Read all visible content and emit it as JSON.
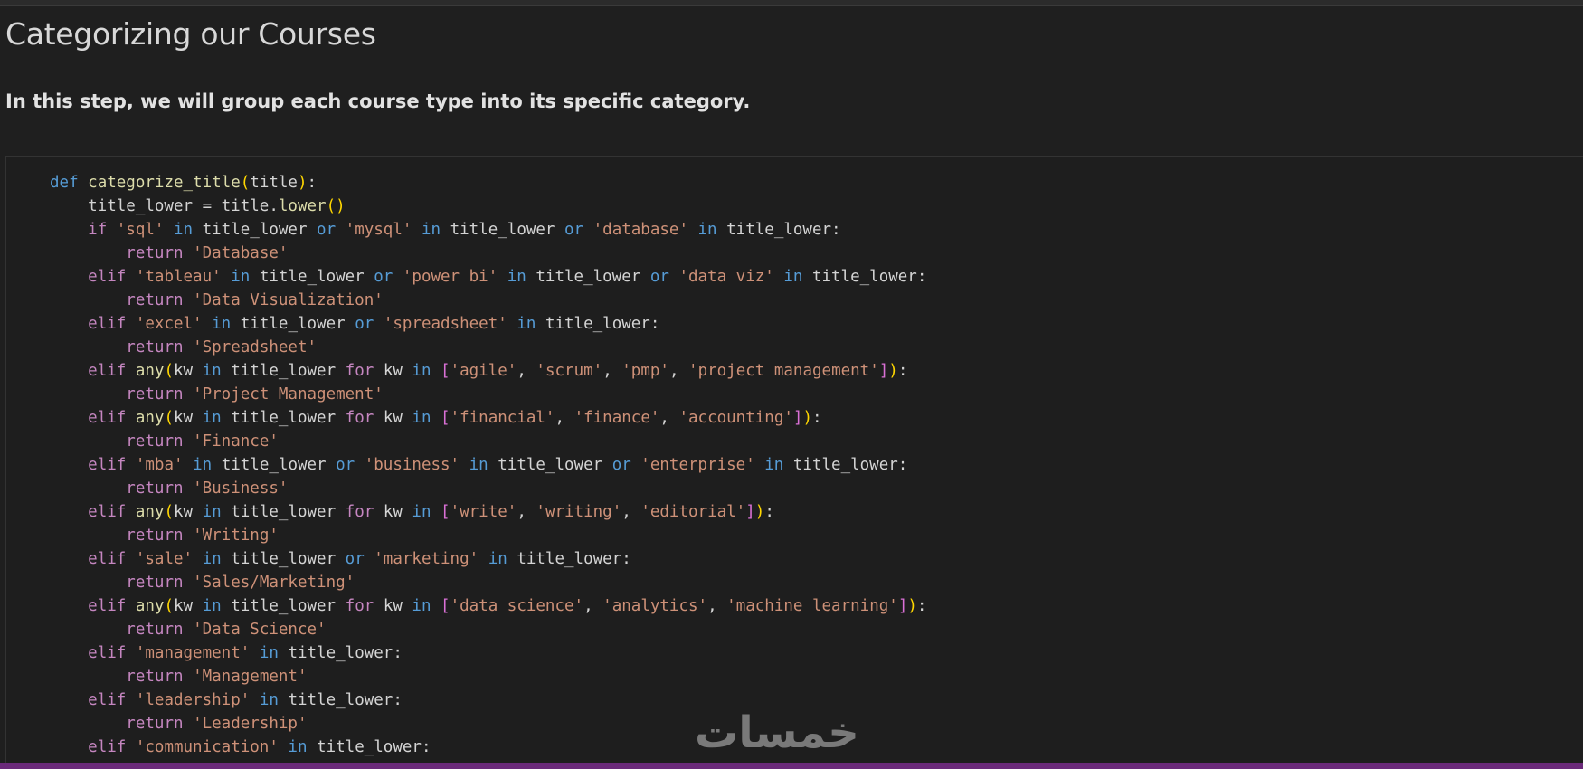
{
  "heading": "Categorizing our Courses",
  "intro": "In this step, we will group each course type into its specific category.",
  "watermark": "خمسات",
  "code_lines": [
    [
      {
        "t": "def ",
        "c": "kw"
      },
      {
        "t": "categorize_title",
        "c": "fn"
      },
      {
        "t": "(",
        "c": "br1"
      },
      {
        "t": "title",
        "c": "id"
      },
      {
        "t": ")",
        "c": "br1"
      },
      {
        "t": ":",
        "c": "id"
      }
    ],
    [
      {
        "t": "    title_lower = title.",
        "c": "id"
      },
      {
        "t": "lower",
        "c": "fn"
      },
      {
        "t": "()",
        "c": "br1"
      }
    ],
    [
      {
        "t": "    ",
        "c": "id"
      },
      {
        "t": "if ",
        "c": "ctl"
      },
      {
        "t": "'sql'",
        "c": "str"
      },
      {
        "t": " in ",
        "c": "kw"
      },
      {
        "t": "title_lower ",
        "c": "id"
      },
      {
        "t": "or ",
        "c": "kw"
      },
      {
        "t": "'mysql'",
        "c": "str"
      },
      {
        "t": " in ",
        "c": "kw"
      },
      {
        "t": "title_lower ",
        "c": "id"
      },
      {
        "t": "or ",
        "c": "kw"
      },
      {
        "t": "'database'",
        "c": "str"
      },
      {
        "t": " in ",
        "c": "kw"
      },
      {
        "t": "title_lower:",
        "c": "id"
      }
    ],
    [
      {
        "t": "        ",
        "c": "id"
      },
      {
        "t": "return ",
        "c": "ctl"
      },
      {
        "t": "'Database'",
        "c": "str"
      }
    ],
    [
      {
        "t": "    ",
        "c": "id"
      },
      {
        "t": "elif ",
        "c": "ctl"
      },
      {
        "t": "'tableau'",
        "c": "str"
      },
      {
        "t": " in ",
        "c": "kw"
      },
      {
        "t": "title_lower ",
        "c": "id"
      },
      {
        "t": "or ",
        "c": "kw"
      },
      {
        "t": "'power bi'",
        "c": "str"
      },
      {
        "t": " in ",
        "c": "kw"
      },
      {
        "t": "title_lower ",
        "c": "id"
      },
      {
        "t": "or ",
        "c": "kw"
      },
      {
        "t": "'data viz'",
        "c": "str"
      },
      {
        "t": " in ",
        "c": "kw"
      },
      {
        "t": "title_lower:",
        "c": "id"
      }
    ],
    [
      {
        "t": "        ",
        "c": "id"
      },
      {
        "t": "return ",
        "c": "ctl"
      },
      {
        "t": "'Data Visualization'",
        "c": "str"
      }
    ],
    [
      {
        "t": "    ",
        "c": "id"
      },
      {
        "t": "elif ",
        "c": "ctl"
      },
      {
        "t": "'excel'",
        "c": "str"
      },
      {
        "t": " in ",
        "c": "kw"
      },
      {
        "t": "title_lower ",
        "c": "id"
      },
      {
        "t": "or ",
        "c": "kw"
      },
      {
        "t": "'spreadsheet'",
        "c": "str"
      },
      {
        "t": " in ",
        "c": "kw"
      },
      {
        "t": "title_lower:",
        "c": "id"
      }
    ],
    [
      {
        "t": "        ",
        "c": "id"
      },
      {
        "t": "return ",
        "c": "ctl"
      },
      {
        "t": "'Spreadsheet'",
        "c": "str"
      }
    ],
    [
      {
        "t": "    ",
        "c": "id"
      },
      {
        "t": "elif ",
        "c": "ctl"
      },
      {
        "t": "any",
        "c": "fn"
      },
      {
        "t": "(",
        "c": "br1"
      },
      {
        "t": "kw ",
        "c": "id"
      },
      {
        "t": "in ",
        "c": "kw"
      },
      {
        "t": "title_lower ",
        "c": "id"
      },
      {
        "t": "for ",
        "c": "ctl"
      },
      {
        "t": "kw ",
        "c": "id"
      },
      {
        "t": "in ",
        "c": "kw"
      },
      {
        "t": "[",
        "c": "br2"
      },
      {
        "t": "'agile'",
        "c": "str"
      },
      {
        "t": ", ",
        "c": "id"
      },
      {
        "t": "'scrum'",
        "c": "str"
      },
      {
        "t": ", ",
        "c": "id"
      },
      {
        "t": "'pmp'",
        "c": "str"
      },
      {
        "t": ", ",
        "c": "id"
      },
      {
        "t": "'project management'",
        "c": "str"
      },
      {
        "t": "]",
        "c": "br2"
      },
      {
        "t": ")",
        "c": "br1"
      },
      {
        "t": ":",
        "c": "id"
      }
    ],
    [
      {
        "t": "        ",
        "c": "id"
      },
      {
        "t": "return ",
        "c": "ctl"
      },
      {
        "t": "'Project Management'",
        "c": "str"
      }
    ],
    [
      {
        "t": "    ",
        "c": "id"
      },
      {
        "t": "elif ",
        "c": "ctl"
      },
      {
        "t": "any",
        "c": "fn"
      },
      {
        "t": "(",
        "c": "br1"
      },
      {
        "t": "kw ",
        "c": "id"
      },
      {
        "t": "in ",
        "c": "kw"
      },
      {
        "t": "title_lower ",
        "c": "id"
      },
      {
        "t": "for ",
        "c": "ctl"
      },
      {
        "t": "kw ",
        "c": "id"
      },
      {
        "t": "in ",
        "c": "kw"
      },
      {
        "t": "[",
        "c": "br2"
      },
      {
        "t": "'financial'",
        "c": "str"
      },
      {
        "t": ", ",
        "c": "id"
      },
      {
        "t": "'finance'",
        "c": "str"
      },
      {
        "t": ", ",
        "c": "id"
      },
      {
        "t": "'accounting'",
        "c": "str"
      },
      {
        "t": "]",
        "c": "br2"
      },
      {
        "t": ")",
        "c": "br1"
      },
      {
        "t": ":",
        "c": "id"
      }
    ],
    [
      {
        "t": "        ",
        "c": "id"
      },
      {
        "t": "return ",
        "c": "ctl"
      },
      {
        "t": "'Finance'",
        "c": "str"
      }
    ],
    [
      {
        "t": "    ",
        "c": "id"
      },
      {
        "t": "elif ",
        "c": "ctl"
      },
      {
        "t": "'mba'",
        "c": "str"
      },
      {
        "t": " in ",
        "c": "kw"
      },
      {
        "t": "title_lower ",
        "c": "id"
      },
      {
        "t": "or ",
        "c": "kw"
      },
      {
        "t": "'business'",
        "c": "str"
      },
      {
        "t": " in ",
        "c": "kw"
      },
      {
        "t": "title_lower ",
        "c": "id"
      },
      {
        "t": "or ",
        "c": "kw"
      },
      {
        "t": "'enterprise'",
        "c": "str"
      },
      {
        "t": " in ",
        "c": "kw"
      },
      {
        "t": "title_lower:",
        "c": "id"
      }
    ],
    [
      {
        "t": "        ",
        "c": "id"
      },
      {
        "t": "return ",
        "c": "ctl"
      },
      {
        "t": "'Business'",
        "c": "str"
      }
    ],
    [
      {
        "t": "    ",
        "c": "id"
      },
      {
        "t": "elif ",
        "c": "ctl"
      },
      {
        "t": "any",
        "c": "fn"
      },
      {
        "t": "(",
        "c": "br1"
      },
      {
        "t": "kw ",
        "c": "id"
      },
      {
        "t": "in ",
        "c": "kw"
      },
      {
        "t": "title_lower ",
        "c": "id"
      },
      {
        "t": "for ",
        "c": "ctl"
      },
      {
        "t": "kw ",
        "c": "id"
      },
      {
        "t": "in ",
        "c": "kw"
      },
      {
        "t": "[",
        "c": "br2"
      },
      {
        "t": "'write'",
        "c": "str"
      },
      {
        "t": ", ",
        "c": "id"
      },
      {
        "t": "'writing'",
        "c": "str"
      },
      {
        "t": ", ",
        "c": "id"
      },
      {
        "t": "'editorial'",
        "c": "str"
      },
      {
        "t": "]",
        "c": "br2"
      },
      {
        "t": ")",
        "c": "br1"
      },
      {
        "t": ":",
        "c": "id"
      }
    ],
    [
      {
        "t": "        ",
        "c": "id"
      },
      {
        "t": "return ",
        "c": "ctl"
      },
      {
        "t": "'Writing'",
        "c": "str"
      }
    ],
    [
      {
        "t": "    ",
        "c": "id"
      },
      {
        "t": "elif ",
        "c": "ctl"
      },
      {
        "t": "'sale'",
        "c": "str"
      },
      {
        "t": " in ",
        "c": "kw"
      },
      {
        "t": "title_lower ",
        "c": "id"
      },
      {
        "t": "or ",
        "c": "kw"
      },
      {
        "t": "'marketing'",
        "c": "str"
      },
      {
        "t": " in ",
        "c": "kw"
      },
      {
        "t": "title_lower:",
        "c": "id"
      }
    ],
    [
      {
        "t": "        ",
        "c": "id"
      },
      {
        "t": "return ",
        "c": "ctl"
      },
      {
        "t": "'Sales/Marketing'",
        "c": "str"
      }
    ],
    [
      {
        "t": "    ",
        "c": "id"
      },
      {
        "t": "elif ",
        "c": "ctl"
      },
      {
        "t": "any",
        "c": "fn"
      },
      {
        "t": "(",
        "c": "br1"
      },
      {
        "t": "kw ",
        "c": "id"
      },
      {
        "t": "in ",
        "c": "kw"
      },
      {
        "t": "title_lower ",
        "c": "id"
      },
      {
        "t": "for ",
        "c": "ctl"
      },
      {
        "t": "kw ",
        "c": "id"
      },
      {
        "t": "in ",
        "c": "kw"
      },
      {
        "t": "[",
        "c": "br2"
      },
      {
        "t": "'data science'",
        "c": "str"
      },
      {
        "t": ", ",
        "c": "id"
      },
      {
        "t": "'analytics'",
        "c": "str"
      },
      {
        "t": ", ",
        "c": "id"
      },
      {
        "t": "'machine learning'",
        "c": "str"
      },
      {
        "t": "]",
        "c": "br2"
      },
      {
        "t": ")",
        "c": "br1"
      },
      {
        "t": ":",
        "c": "id"
      }
    ],
    [
      {
        "t": "        ",
        "c": "id"
      },
      {
        "t": "return ",
        "c": "ctl"
      },
      {
        "t": "'Data Science'",
        "c": "str"
      }
    ],
    [
      {
        "t": "    ",
        "c": "id"
      },
      {
        "t": "elif ",
        "c": "ctl"
      },
      {
        "t": "'management'",
        "c": "str"
      },
      {
        "t": " in ",
        "c": "kw"
      },
      {
        "t": "title_lower:",
        "c": "id"
      }
    ],
    [
      {
        "t": "        ",
        "c": "id"
      },
      {
        "t": "return ",
        "c": "ctl"
      },
      {
        "t": "'Management'",
        "c": "str"
      }
    ],
    [
      {
        "t": "    ",
        "c": "id"
      },
      {
        "t": "elif ",
        "c": "ctl"
      },
      {
        "t": "'leadership'",
        "c": "str"
      },
      {
        "t": " in ",
        "c": "kw"
      },
      {
        "t": "title_lower:",
        "c": "id"
      }
    ],
    [
      {
        "t": "        ",
        "c": "id"
      },
      {
        "t": "return ",
        "c": "ctl"
      },
      {
        "t": "'Leadership'",
        "c": "str"
      }
    ],
    [
      {
        "t": "    ",
        "c": "id"
      },
      {
        "t": "elif ",
        "c": "ctl"
      },
      {
        "t": "'communication'",
        "c": "str"
      },
      {
        "t": " in ",
        "c": "kw"
      },
      {
        "t": "title_lower:",
        "c": "id"
      }
    ]
  ]
}
